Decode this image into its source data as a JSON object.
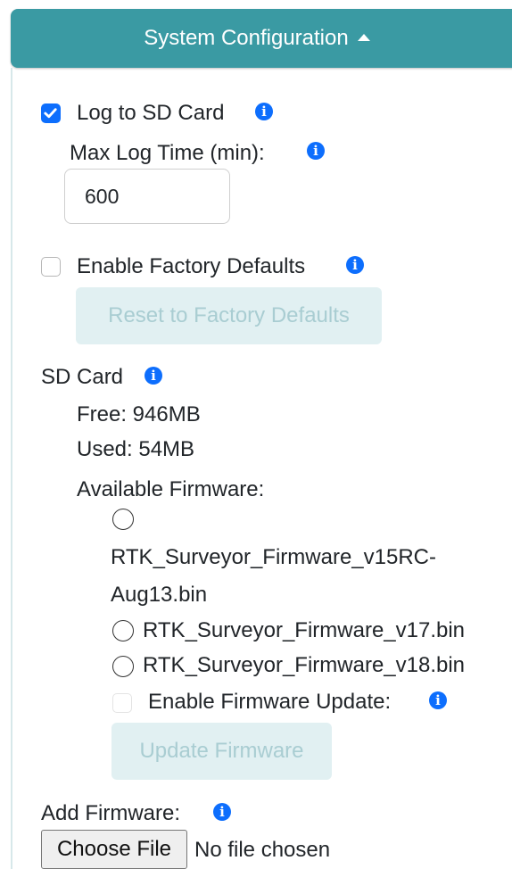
{
  "header": {
    "title": "System Configuration"
  },
  "logging": {
    "log_to_sd_label": "Log to SD Card",
    "log_to_sd_checked": true,
    "max_log_time_label": "Max Log Time (min):",
    "max_log_time_value": "600"
  },
  "factory": {
    "enable_label": "Enable Factory Defaults",
    "enable_checked": false,
    "reset_button": "Reset to Factory Defaults"
  },
  "sd_card": {
    "label": "SD Card",
    "free": "Free: 946MB",
    "used": "Used: 54MB",
    "available_firmware_label": "Available Firmware:",
    "firmware_files": [
      {
        "line1": "RTK_Surveyor_Firmware_v15RC-",
        "line2": "Aug13.bin"
      },
      {
        "name": "RTK_Surveyor_Firmware_v17.bin"
      },
      {
        "name": "RTK_Surveyor_Firmware_v18.bin"
      }
    ],
    "enable_update_label": "Enable Firmware Update:",
    "enable_update_checked": false,
    "update_button": "Update Firmware"
  },
  "add_firmware": {
    "label": "Add Firmware:",
    "choose_button": "Choose File",
    "no_file_text": "No file chosen"
  },
  "icons": {
    "info": "info-icon",
    "check": "checkmark-icon",
    "caret": "caret-up-icon"
  },
  "colors": {
    "header": "#3a9aa3",
    "accent": "#0d6efd",
    "disabled_button_bg": "#e1f0f2",
    "disabled_button_text": "#a9cdd2"
  }
}
